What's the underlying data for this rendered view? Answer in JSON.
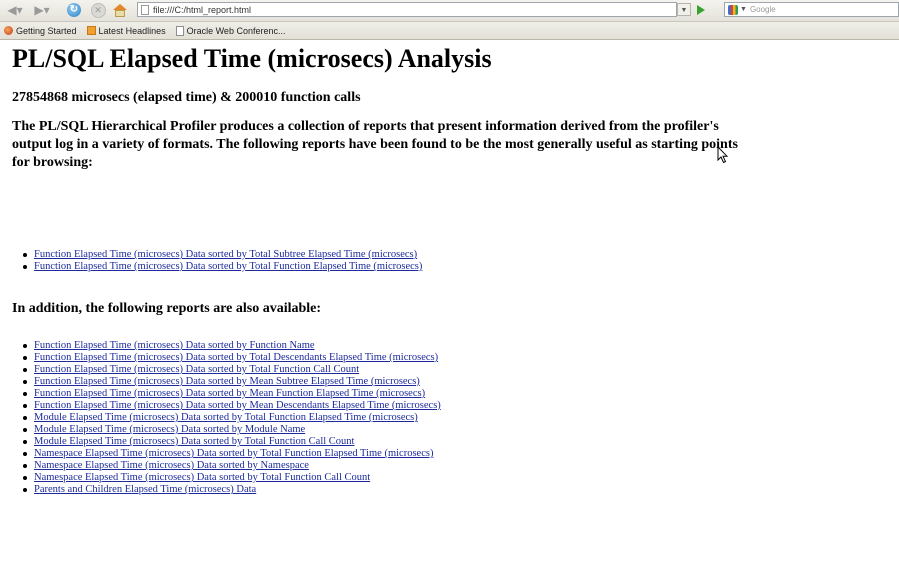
{
  "browser": {
    "nav": {
      "back_icon": "back-arrow-icon",
      "forward_icon": "forward-arrow-icon",
      "reload_icon": "reload-icon",
      "stop_icon": "stop-icon",
      "home_icon": "home-icon"
    },
    "url": "file:///C:/html_report.html",
    "search_placeholder": "Google",
    "bookmarks": [
      {
        "label": "Getting Started",
        "icon": "firefox-icon"
      },
      {
        "label": "Latest Headlines",
        "icon": "rss-icon"
      },
      {
        "label": "Oracle Web Conferenc...",
        "icon": "page-icon"
      }
    ]
  },
  "page": {
    "title": "PL/SQL Elapsed Time (microsecs) Analysis",
    "summary": "27854868 microsecs (elapsed time) & 200010 function calls",
    "intro_lines": [
      "The PL/SQL Hierarchical Profiler produces a collection of reports that present information derived from the profiler's",
      "output log in a variety of formats. The following reports have been found to be the most generally useful as starting points",
      "for browsing:"
    ],
    "primary_reports": [
      "Function Elapsed Time (microsecs) Data sorted by Total Subtree Elapsed Time (microsecs)",
      "Function Elapsed Time (microsecs) Data sorted by Total Function Elapsed Time (microsecs)"
    ],
    "also_heading": "In addition, the following reports are also available:",
    "secondary_reports": [
      "Function Elapsed Time (microsecs) Data sorted by Function Name",
      "Function Elapsed Time (microsecs) Data sorted by Total Descendants Elapsed Time (microsecs)",
      "Function Elapsed Time (microsecs) Data sorted by Total Function Call Count",
      "Function Elapsed Time (microsecs) Data sorted by Mean Subtree Elapsed Time (microsecs)",
      "Function Elapsed Time (microsecs) Data sorted by Mean Function Elapsed Time (microsecs)",
      "Function Elapsed Time (microsecs) Data sorted by Mean Descendants Elapsed Time (microsecs)",
      "Module Elapsed Time (microsecs) Data sorted by Total Function Elapsed Time (microsecs)",
      "Module Elapsed Time (microsecs) Data sorted by Module Name",
      "Module Elapsed Time (microsecs) Data sorted by Total Function Call Count",
      "Namespace Elapsed Time (microsecs) Data sorted by Total Function Elapsed Time (microsecs)",
      "Namespace Elapsed Time (microsecs) Data sorted by Namespace",
      "Namespace Elapsed Time (microsecs) Data sorted by Total Function Call Count",
      "Parents and Children Elapsed Time (microsecs) Data"
    ],
    "link_color": "#1c2a9c"
  }
}
